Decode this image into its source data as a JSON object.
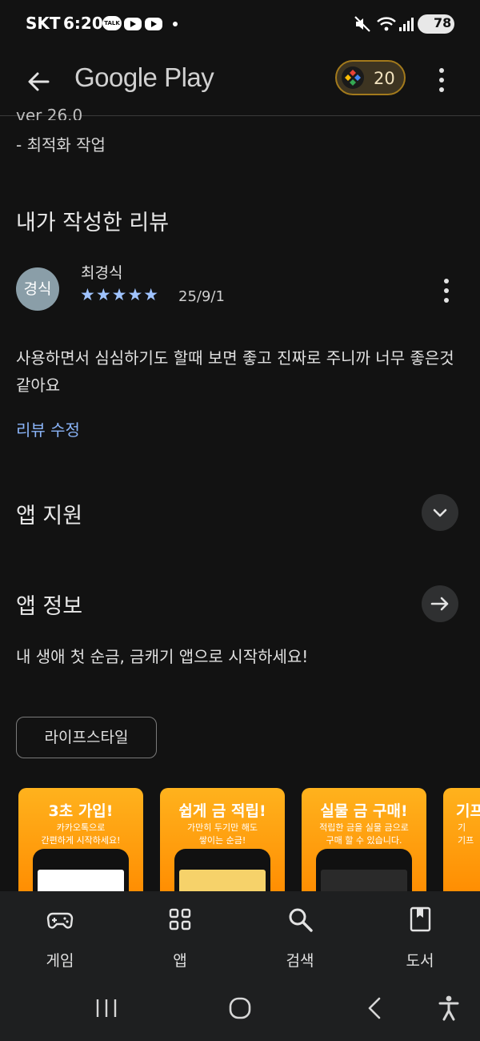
{
  "status_bar": {
    "carrier": "SKT",
    "time": "6:20",
    "talk_badge": "TALK",
    "battery": "78"
  },
  "app_bar": {
    "title": "Google Play",
    "points": "20"
  },
  "whats_new": {
    "version_cut": "ver 26.0",
    "note": "- 최적화 작업"
  },
  "my_review": {
    "heading": "내가 작성한 리뷰",
    "avatar_text": "경식",
    "reviewer_name": "최경식",
    "stars": "★★★★★",
    "date": "25/9/1",
    "text": "사용하면서 심심하기도 할때 보면 좋고 진짜로 주니까 너무 좋은것 같아요",
    "edit_link": "리뷰 수정"
  },
  "app_support": {
    "heading": "앱 지원"
  },
  "app_info": {
    "heading": "앱 정보",
    "description": "내 생애 첫 순금, 금캐기 앱으로 시작하세요!",
    "category_chip": "라이프스타일"
  },
  "screenshots": [
    {
      "title": "3초 가입!",
      "subtitle_1": "카카오톡으로",
      "subtitle_2": "간편하게 시작하세요!"
    },
    {
      "title": "쉽게 금 적립!",
      "subtitle_1": "가만히 두기만 해도",
      "subtitle_2": "쌓이는 순금!"
    },
    {
      "title": "실물 금 구매!",
      "subtitle_1": "적립한 금을 실물 금으로",
      "subtitle_2": "구매 할 수 있습니다."
    },
    {
      "title": "기프",
      "subtitle_1": "기",
      "subtitle_2": "기프"
    }
  ],
  "bottom_nav": {
    "items": [
      {
        "label": "게임",
        "icon": "gamepad-icon"
      },
      {
        "label": "앱",
        "icon": "apps-grid-icon"
      },
      {
        "label": "검색",
        "icon": "search-icon"
      },
      {
        "label": "도서",
        "icon": "book-icon"
      }
    ]
  },
  "colors": {
    "background": "#121212",
    "link": "#8ab4f8",
    "star": "#9fc3ff",
    "points_border": "#a37a1c",
    "screenshot_orange": "#ff9f10"
  }
}
